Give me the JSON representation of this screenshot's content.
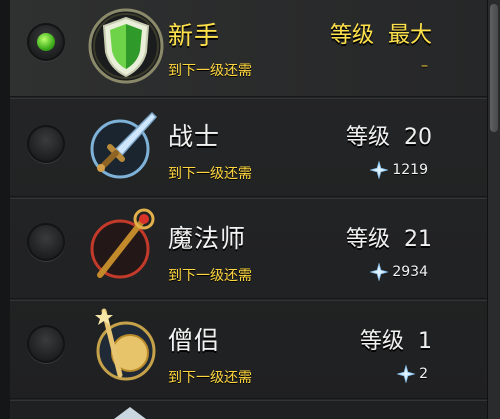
{
  "classes": [
    {
      "name": "新手",
      "level_label": "等级",
      "level_value": "最大",
      "next_label": "到下一级还需",
      "cost": "–",
      "selected": true,
      "icon": "shield-icon"
    },
    {
      "name": "战士",
      "level_label": "等级",
      "level_value": "20",
      "next_label": "到下一级还需",
      "cost": "1219",
      "selected": false,
      "icon": "sword-icon"
    },
    {
      "name": "魔法师",
      "level_label": "等级",
      "level_value": "21",
      "next_label": "到下一级还需",
      "cost": "2934",
      "selected": false,
      "icon": "staff-icon"
    },
    {
      "name": "僧侣",
      "level_label": "等级",
      "level_value": "1",
      "next_label": "到下一级还需",
      "cost": "2",
      "selected": false,
      "icon": "holy-staff-icon"
    }
  ],
  "colors": {
    "accent_gold": "#ffe14a",
    "radio_active": "#3fae1c"
  }
}
